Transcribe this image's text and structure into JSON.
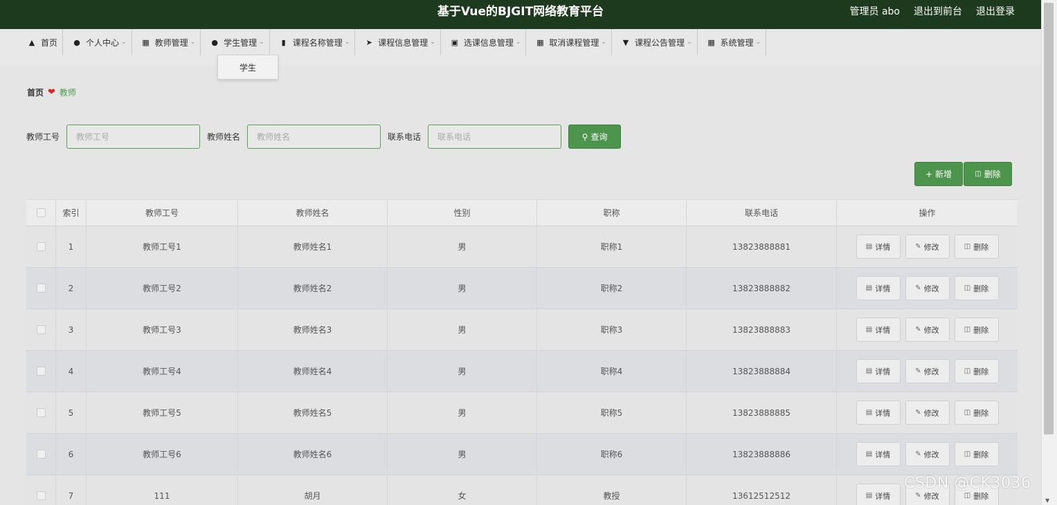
{
  "header": {
    "title": "基于Vue的BJGIT网络教育平台",
    "user_label": "管理员 abo",
    "front_label": "退出到前台",
    "logout_label": "退出登录"
  },
  "menu": {
    "items": [
      {
        "label": "首页",
        "icon": "home-icon",
        "has_dropdown": false
      },
      {
        "label": "个人中心",
        "icon": "user-icon",
        "has_dropdown": true
      },
      {
        "label": "教师管理",
        "icon": "grid-icon",
        "has_dropdown": true
      },
      {
        "label": "学生管理",
        "icon": "user-icon",
        "has_dropdown": true
      },
      {
        "label": "课程名称管理",
        "icon": "books-icon",
        "has_dropdown": true
      },
      {
        "label": "课程信息管理",
        "icon": "send-icon",
        "has_dropdown": true
      },
      {
        "label": "选课信息管理",
        "icon": "clipboard-icon",
        "has_dropdown": true
      },
      {
        "label": "取消课程管理",
        "icon": "grid-icon",
        "has_dropdown": true
      },
      {
        "label": "课程公告管理",
        "icon": "pin-icon",
        "has_dropdown": true
      },
      {
        "label": "系统管理",
        "icon": "grid-icon",
        "has_dropdown": true
      }
    ],
    "open_dropdown": {
      "item": "学生管理",
      "options": [
        "学生"
      ]
    }
  },
  "breadcrumb": {
    "home": "首页",
    "current": "教师"
  },
  "search": {
    "fields": [
      {
        "label": "教师工号",
        "placeholder": "教师工号",
        "value": ""
      },
      {
        "label": "教师姓名",
        "placeholder": "教师姓名",
        "value": ""
      },
      {
        "label": "联系电话",
        "placeholder": "联系电话",
        "value": ""
      }
    ],
    "query_label": "查询"
  },
  "actions": {
    "add_label": "新增",
    "delete_label": "删除"
  },
  "table": {
    "columns": [
      "索引",
      "教师工号",
      "教师姓名",
      "性别",
      "职称",
      "联系电话",
      "操作"
    ],
    "row_actions": {
      "detail": "详情",
      "edit": "修改",
      "delete": "删除"
    },
    "rows": [
      {
        "index": "1",
        "id": "教师工号1",
        "name": "教师姓名1",
        "gender": "男",
        "title": "职称1",
        "phone": "13823888881"
      },
      {
        "index": "2",
        "id": "教师工号2",
        "name": "教师姓名2",
        "gender": "男",
        "title": "职称2",
        "phone": "13823888882"
      },
      {
        "index": "3",
        "id": "教师工号3",
        "name": "教师姓名3",
        "gender": "男",
        "title": "职称3",
        "phone": "13823888883"
      },
      {
        "index": "4",
        "id": "教师工号4",
        "name": "教师姓名4",
        "gender": "男",
        "title": "职称4",
        "phone": "13823888884"
      },
      {
        "index": "5",
        "id": "教师工号5",
        "name": "教师姓名5",
        "gender": "男",
        "title": "职称5",
        "phone": "13823888885"
      },
      {
        "index": "6",
        "id": "教师工号6",
        "name": "教师姓名6",
        "gender": "男",
        "title": "职称6",
        "phone": "13823888886"
      },
      {
        "index": "7",
        "id": "111",
        "name": "胡月",
        "gender": "女",
        "title": "教授",
        "phone": "13612512512"
      }
    ]
  },
  "watermark": "CSDN @CK3036",
  "colors": {
    "topbar": "#1e3a1e",
    "accent_green": "#4d944d",
    "heart": "#e02020"
  }
}
